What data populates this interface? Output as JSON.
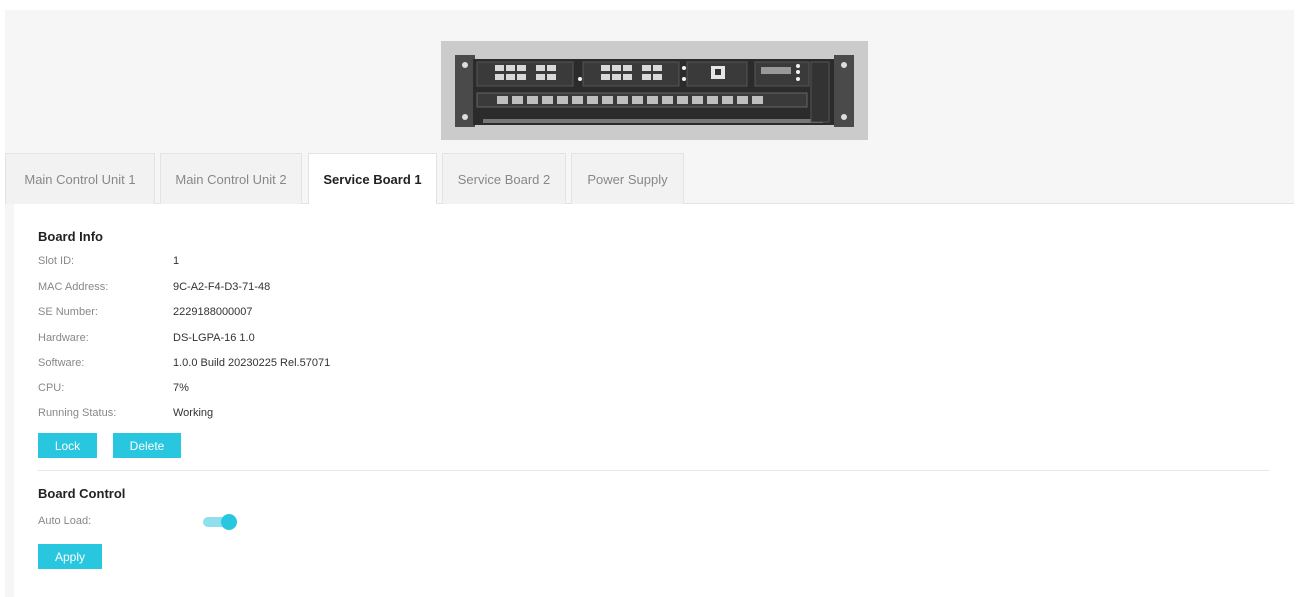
{
  "device_image": {
    "alt": "Device chassis front panel"
  },
  "tabs": [
    {
      "label": "Main Control Unit 1",
      "active": false
    },
    {
      "label": "Main Control Unit 2",
      "active": false
    },
    {
      "label": "Service Board 1",
      "active": true
    },
    {
      "label": "Service Board 2",
      "active": false
    },
    {
      "label": "Power Supply",
      "active": false
    }
  ],
  "board_info": {
    "title": "Board Info",
    "rows": [
      {
        "label": "Slot ID:",
        "value": "1"
      },
      {
        "label": "MAC Address:",
        "value": "9C-A2-F4-D3-71-48"
      },
      {
        "label": "SE Number:",
        "value": "2229188000007"
      },
      {
        "label": "Hardware:",
        "value": "DS-LGPA-16 1.0"
      },
      {
        "label": "Software:",
        "value": "1.0.0 Build 20230225 Rel.57071"
      },
      {
        "label": "CPU:",
        "value": "7%"
      },
      {
        "label": "Running Status:",
        "value": "Working"
      }
    ],
    "lock_label": "Lock",
    "delete_label": "Delete"
  },
  "board_control": {
    "title": "Board Control",
    "auto_load_label": "Auto Load:",
    "auto_load_enabled": true,
    "apply_label": "Apply"
  },
  "colors": {
    "accent": "#28c7df",
    "toggle_track": "#8fe0ec"
  }
}
